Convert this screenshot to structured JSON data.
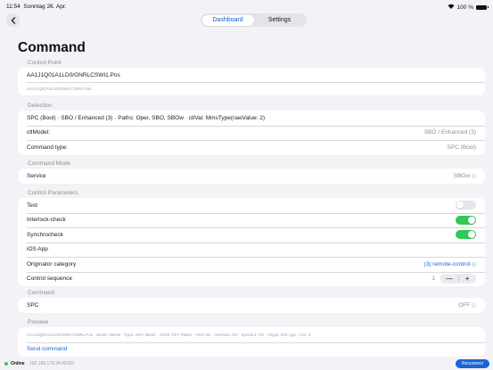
{
  "status_bar": {
    "time": "11:54",
    "date": "Sonntag 26. Apr.",
    "battery": "100 %",
    "wifi_icon": "wifi-icon"
  },
  "nav": {
    "back_icon": "chevron-left-icon",
    "tabs": [
      {
        "label": "Dashboard",
        "active": true
      },
      {
        "label": "Settings",
        "active": false
      }
    ]
  },
  "page_title": "Command",
  "control_point": {
    "header": "Control Point",
    "value": "AA1J1Q01A1LD0/GNRLCSWI1.Pos",
    "subtitle": "AA1J1Q01A1LD0/GNRLCSWI1.Pos"
  },
  "detection": {
    "header": "Detection",
    "summary": "SPC (Bool) · SBO / Enhanced (3) · Paths: Oper, SBO, SBOw · ctlVal: MmsType(rawValue: 2)",
    "ctl_model_label": "ctlModel:",
    "ctl_model_value": "SBO / Enhanced (3)",
    "command_type_label": "Command type:",
    "command_type_value": "SPC (Bool)"
  },
  "command_mode": {
    "header": "Command Mode",
    "service_label": "Service",
    "service_value": "SBOw ◇"
  },
  "control_parameters": {
    "header": "Control Parameters",
    "test_label": "Test",
    "test_on": false,
    "interlock_label": "Interlock-check",
    "interlock_on": true,
    "synchro_label": "Synchrocheck",
    "synchro_on": true,
    "ios_app_label": "iOS App",
    "originator_label": "Originator category",
    "originator_value": "(3) remote-control ◇",
    "sequence_label": "Control sequence",
    "sequence_value": "1",
    "minus": "—",
    "plus": "+"
  },
  "command": {
    "header": "Command",
    "spc_label": "SPC",
    "spc_value": "OFF ◇"
  },
  "preview": {
    "header": "Preview",
    "text": "AA1J1Q01A1LD0/GNRLCSWI1.Pos · Mode: SBOw · Type: SPC (Bool) · ctlVal: OFF (false) · Test: No · Interlock: On · Synchro: On · Origin: iOS App · Cat: 3",
    "send_label": "Send command"
  },
  "footer": {
    "status": "Online",
    "ip": "192.168.178.34:49153",
    "reconnect_label": "Reconnect",
    "online_color": "#34c759"
  },
  "colors": {
    "accent": "#1a64d8",
    "toggle_on": "#34c759",
    "background": "#f2f2f7"
  }
}
